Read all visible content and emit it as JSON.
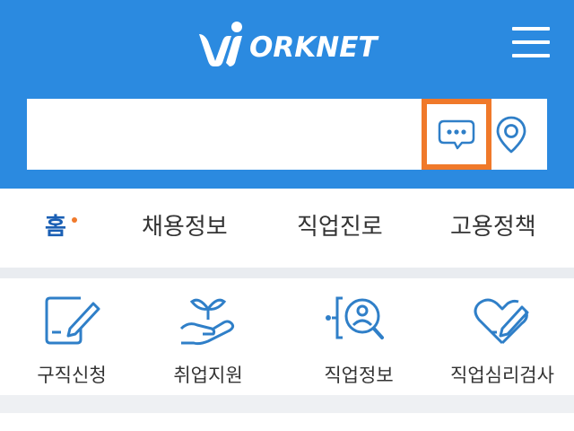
{
  "header": {
    "logo_text": "ORKNET",
    "background_color": "#2b8ae0",
    "menu_icon": "hamburger-menu-icon"
  },
  "search": {
    "value": "",
    "placeholder": "",
    "chat_icon": "speech-bubble-icon",
    "location_icon": "map-pin-icon",
    "highlight_color": "#f0792a"
  },
  "tabs": [
    {
      "label": "홈",
      "active": true
    },
    {
      "label": "채용정보",
      "active": false
    },
    {
      "label": "직업진로",
      "active": false
    },
    {
      "label": "고용정책",
      "active": false
    }
  ],
  "quick_menu": [
    {
      "label": "구직신청",
      "icon": "edit-document-icon"
    },
    {
      "label": "취업지원",
      "icon": "plant-in-hand-icon"
    },
    {
      "label": "직업정보",
      "icon": "person-search-icon"
    },
    {
      "label": "직업심리검사",
      "icon": "heart-pen-icon"
    }
  ],
  "colors": {
    "accent": "#2b8ae0",
    "active_tab": "#1a5fb4",
    "dot": "#f07a2c",
    "icon_stroke": "#2f7fc8"
  }
}
